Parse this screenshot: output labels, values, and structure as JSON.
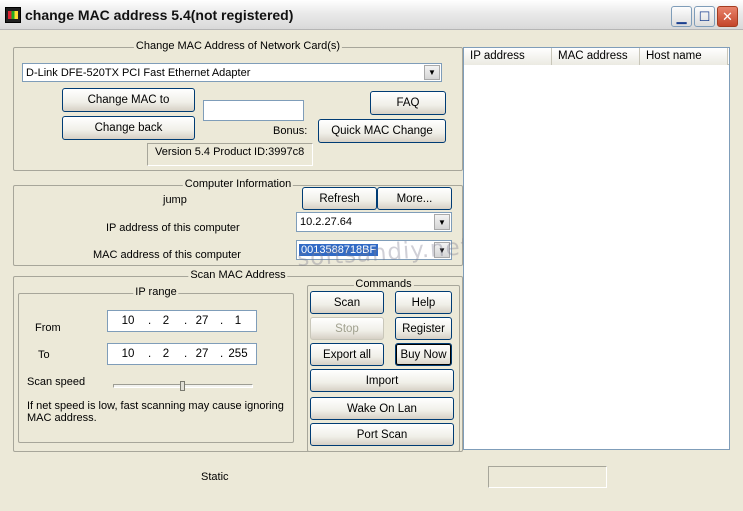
{
  "window": {
    "title": "change MAC address 5.4(not registered)",
    "min_glyph": "▁",
    "max_glyph": "☐",
    "close_glyph": "✕"
  },
  "network_card": {
    "group_title": "Change MAC  Address of Network Card(s)",
    "adapter": "D-Link DFE-520TX PCI Fast Ethernet Adapter",
    "change_mac_label": "Change MAC to",
    "change_back_label": "Change back",
    "faq_label": "FAQ",
    "quick_change_label": "Quick MAC Change",
    "bonus_label": "Bonus:",
    "mac_input_value": "",
    "version_text": "Version 5.4  Product ID:3997c8"
  },
  "computer_info": {
    "group_title": "Computer Information",
    "jump_label": "jump",
    "refresh_label": "Refresh",
    "more_label": "More...",
    "ip_label": "IP address of this computer",
    "ip_value": "10.2.27.64",
    "mac_label": "MAC address of this computer",
    "mac_value": "0013588718BF"
  },
  "scan": {
    "group_title": "Scan MAC Address",
    "ip_range_title": "IP range",
    "from_label": "From",
    "from_octets": [
      "10",
      "2",
      "27",
      "1"
    ],
    "to_label": "To",
    "to_octets": [
      "10",
      "2",
      "27",
      "255"
    ],
    "dot": ".",
    "speed_label": "Scan speed",
    "speed_level": 0.5,
    "note_line1": "If net speed is low,  fast scanning may cause ignoring",
    "note_line2": "MAC address."
  },
  "commands": {
    "group_title": "Commands",
    "scan_label": "Scan",
    "help_label": "Help",
    "stop_label": "Stop",
    "register_label": "Register",
    "export_label": "Export all",
    "buy_label": "Buy Now",
    "import_label": "Import",
    "wol_label": "Wake On Lan",
    "portscan_label": "Port Scan"
  },
  "results": {
    "columns": [
      "IP address",
      "MAC address",
      "Host name"
    ]
  },
  "status": {
    "text": "Static",
    "field_value": ""
  },
  "watermark": "softsandiy.net",
  "icons": {
    "app": "app-icon",
    "dropdown": "▼"
  }
}
